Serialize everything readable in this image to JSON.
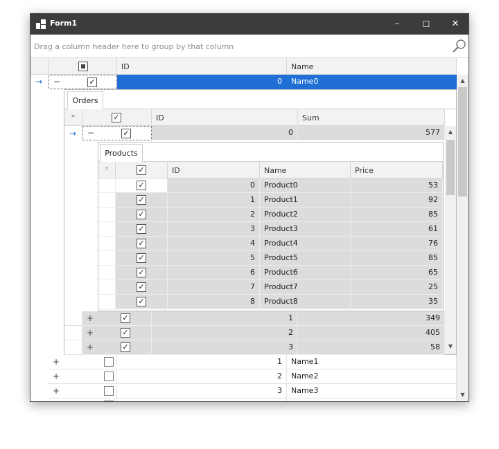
{
  "window": {
    "title": "Form1",
    "minimize": "–",
    "maximize": "☐",
    "close": "✕"
  },
  "group_panel": {
    "placeholder": "Drag a column header here to group by that column"
  },
  "main_grid": {
    "columns": [
      "ID",
      "Name"
    ],
    "rows": [
      {
        "id": "0",
        "name": "Name0",
        "checked": true
      },
      {
        "id": "1",
        "name": "Name1",
        "checked": false
      },
      {
        "id": "2",
        "name": "Name2",
        "checked": false
      },
      {
        "id": "3",
        "name": "Name3",
        "checked": false
      }
    ]
  },
  "orders": {
    "tab": "Orders",
    "columns": [
      "ID",
      "Sum"
    ],
    "rows": [
      {
        "id": "0",
        "sum": "577"
      },
      {
        "id": "1",
        "sum": "349"
      },
      {
        "id": "2",
        "sum": "405"
      },
      {
        "id": "3",
        "sum": "58"
      }
    ]
  },
  "products": {
    "tab": "Products",
    "columns": [
      "ID",
      "Name",
      "Price"
    ],
    "rows": [
      {
        "id": "0",
        "name": "Product0",
        "price": "53"
      },
      {
        "id": "1",
        "name": "Product1",
        "price": "92"
      },
      {
        "id": "2",
        "name": "Product2",
        "price": "85"
      },
      {
        "id": "3",
        "name": "Product3",
        "price": "61"
      },
      {
        "id": "4",
        "name": "Product4",
        "price": "76"
      },
      {
        "id": "5",
        "name": "Product5",
        "price": "85"
      },
      {
        "id": "6",
        "name": "Product6",
        "price": "65"
      },
      {
        "id": "7",
        "name": "Product7",
        "price": "25"
      },
      {
        "id": "8",
        "name": "Product8",
        "price": "35"
      }
    ]
  },
  "glyphs": {
    "check": "✓",
    "collapse": "−",
    "expand": "+",
    "focus_arrow": "→",
    "scroll_up": "▲",
    "scroll_down": "▼",
    "column_chooser": "⌗"
  }
}
